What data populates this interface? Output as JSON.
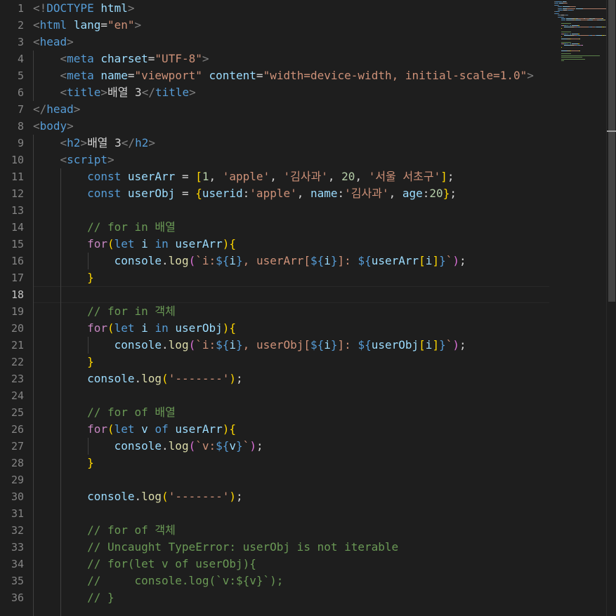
{
  "editor": {
    "active_line": "18",
    "line_numbers": [
      "1",
      "2",
      "3",
      "4",
      "5",
      "6",
      "7",
      "8",
      "9",
      "10",
      "11",
      "12",
      "13",
      "14",
      "15",
      "16",
      "17",
      "18",
      "19",
      "20",
      "21",
      "22",
      "23",
      "24",
      "25",
      "26",
      "27",
      "28",
      "29",
      "30",
      "31",
      "32",
      "33",
      "34",
      "35",
      "36"
    ],
    "lines": [
      [
        [
          "t-br",
          "<!"
        ],
        [
          "t-tag",
          "DOCTYPE"
        ],
        [
          "t-txt",
          " "
        ],
        [
          "t-attr",
          "html"
        ],
        [
          "t-br",
          ">"
        ]
      ],
      [
        [
          "t-br",
          "<"
        ],
        [
          "t-tag",
          "html"
        ],
        [
          "t-txt",
          " "
        ],
        [
          "t-attr",
          "lang"
        ],
        [
          "t-txt",
          "="
        ],
        [
          "t-str",
          "\"en\""
        ],
        [
          "t-br",
          ">"
        ]
      ],
      [
        [
          "t-br",
          "<"
        ],
        [
          "t-tag",
          "head"
        ],
        [
          "t-br",
          ">"
        ]
      ],
      [
        [
          "t-txt",
          "    "
        ],
        [
          "t-br",
          "<"
        ],
        [
          "t-tag",
          "meta"
        ],
        [
          "t-txt",
          " "
        ],
        [
          "t-attr",
          "charset"
        ],
        [
          "t-txt",
          "="
        ],
        [
          "t-str",
          "\"UTF-8\""
        ],
        [
          "t-br",
          ">"
        ]
      ],
      [
        [
          "t-txt",
          "    "
        ],
        [
          "t-br",
          "<"
        ],
        [
          "t-tag",
          "meta"
        ],
        [
          "t-txt",
          " "
        ],
        [
          "t-attr",
          "name"
        ],
        [
          "t-txt",
          "="
        ],
        [
          "t-str",
          "\"viewport\""
        ],
        [
          "t-txt",
          " "
        ],
        [
          "t-attr",
          "content"
        ],
        [
          "t-txt",
          "="
        ],
        [
          "t-str",
          "\"width=device-width, initial-scale=1.0\""
        ],
        [
          "t-br",
          ">"
        ]
      ],
      [
        [
          "t-txt",
          "    "
        ],
        [
          "t-br",
          "<"
        ],
        [
          "t-tag",
          "title"
        ],
        [
          "t-br",
          ">"
        ],
        [
          "t-txt",
          "배열 3"
        ],
        [
          "t-br",
          "</"
        ],
        [
          "t-tag",
          "title"
        ],
        [
          "t-br",
          ">"
        ]
      ],
      [
        [
          "t-br",
          "</"
        ],
        [
          "t-tag",
          "head"
        ],
        [
          "t-br",
          ">"
        ]
      ],
      [
        [
          "t-br",
          "<"
        ],
        [
          "t-tag",
          "body"
        ],
        [
          "t-br",
          ">"
        ]
      ],
      [
        [
          "t-txt",
          "    "
        ],
        [
          "t-br",
          "<"
        ],
        [
          "t-tag",
          "h2"
        ],
        [
          "t-br",
          ">"
        ],
        [
          "t-txt",
          "배열 3"
        ],
        [
          "t-br",
          "</"
        ],
        [
          "t-tag",
          "h2"
        ],
        [
          "t-br",
          ">"
        ]
      ],
      [
        [
          "t-txt",
          "    "
        ],
        [
          "t-br",
          "<"
        ],
        [
          "t-tag",
          "script"
        ],
        [
          "t-br",
          ">"
        ]
      ],
      [
        [
          "t-txt",
          "        "
        ],
        [
          "t-kw",
          "const"
        ],
        [
          "t-txt",
          " "
        ],
        [
          "t-var",
          "userArr"
        ],
        [
          "t-txt",
          " = "
        ],
        [
          "t-p1",
          "["
        ],
        [
          "t-num",
          "1"
        ],
        [
          "t-txt",
          ", "
        ],
        [
          "t-str",
          "'apple'"
        ],
        [
          "t-txt",
          ", "
        ],
        [
          "t-str",
          "'김사과'"
        ],
        [
          "t-txt",
          ", "
        ],
        [
          "t-num",
          "20"
        ],
        [
          "t-txt",
          ", "
        ],
        [
          "t-str",
          "'서울 서초구'"
        ],
        [
          "t-p1",
          "]"
        ],
        [
          "t-txt",
          ";"
        ]
      ],
      [
        [
          "t-txt",
          "        "
        ],
        [
          "t-kw",
          "const"
        ],
        [
          "t-txt",
          " "
        ],
        [
          "t-var",
          "userObj"
        ],
        [
          "t-txt",
          " = "
        ],
        [
          "t-p1",
          "{"
        ],
        [
          "t-var",
          "userid"
        ],
        [
          "t-txt",
          ":"
        ],
        [
          "t-str",
          "'apple'"
        ],
        [
          "t-txt",
          ", "
        ],
        [
          "t-var",
          "name"
        ],
        [
          "t-txt",
          ":"
        ],
        [
          "t-str",
          "'김사과'"
        ],
        [
          "t-txt",
          ", "
        ],
        [
          "t-var",
          "age"
        ],
        [
          "t-txt",
          ":"
        ],
        [
          "t-num",
          "20"
        ],
        [
          "t-p1",
          "}"
        ],
        [
          "t-txt",
          ";"
        ]
      ],
      [],
      [
        [
          "t-txt",
          "        "
        ],
        [
          "t-com",
          "// for in 배열"
        ]
      ],
      [
        [
          "t-txt",
          "        "
        ],
        [
          "t-ctl",
          "for"
        ],
        [
          "t-p1",
          "("
        ],
        [
          "t-kw",
          "let"
        ],
        [
          "t-txt",
          " "
        ],
        [
          "t-var",
          "i"
        ],
        [
          "t-txt",
          " "
        ],
        [
          "t-kw",
          "in"
        ],
        [
          "t-txt",
          " "
        ],
        [
          "t-var",
          "userArr"
        ],
        [
          "t-p1",
          ")"
        ],
        [
          "t-p1",
          "{"
        ]
      ],
      [
        [
          "t-txt",
          "            "
        ],
        [
          "t-var",
          "console"
        ],
        [
          "t-txt",
          "."
        ],
        [
          "t-fn",
          "log"
        ],
        [
          "t-p2",
          "("
        ],
        [
          "t-str",
          "`i:"
        ],
        [
          "t-kw",
          "${"
        ],
        [
          "t-var",
          "i"
        ],
        [
          "t-kw",
          "}"
        ],
        [
          "t-str",
          ", userArr["
        ],
        [
          "t-kw",
          "${"
        ],
        [
          "t-var",
          "i"
        ],
        [
          "t-kw",
          "}"
        ],
        [
          "t-str",
          "]: "
        ],
        [
          "t-kw",
          "${"
        ],
        [
          "t-var",
          "userArr"
        ],
        [
          "t-p1",
          "["
        ],
        [
          "t-var",
          "i"
        ],
        [
          "t-p1",
          "]"
        ],
        [
          "t-kw",
          "}"
        ],
        [
          "t-str",
          "`"
        ],
        [
          "t-p2",
          ")"
        ],
        [
          "t-txt",
          ";"
        ]
      ],
      [
        [
          "t-txt",
          "        "
        ],
        [
          "t-p1",
          "}"
        ]
      ],
      [],
      [
        [
          "t-txt",
          "        "
        ],
        [
          "t-com",
          "// for in 객체"
        ]
      ],
      [
        [
          "t-txt",
          "        "
        ],
        [
          "t-ctl",
          "for"
        ],
        [
          "t-p1",
          "("
        ],
        [
          "t-kw",
          "let"
        ],
        [
          "t-txt",
          " "
        ],
        [
          "t-var",
          "i"
        ],
        [
          "t-txt",
          " "
        ],
        [
          "t-kw",
          "in"
        ],
        [
          "t-txt",
          " "
        ],
        [
          "t-var",
          "userObj"
        ],
        [
          "t-p1",
          ")"
        ],
        [
          "t-p1",
          "{"
        ]
      ],
      [
        [
          "t-txt",
          "            "
        ],
        [
          "t-var",
          "console"
        ],
        [
          "t-txt",
          "."
        ],
        [
          "t-fn",
          "log"
        ],
        [
          "t-p2",
          "("
        ],
        [
          "t-str",
          "`i:"
        ],
        [
          "t-kw",
          "${"
        ],
        [
          "t-var",
          "i"
        ],
        [
          "t-kw",
          "}"
        ],
        [
          "t-str",
          ", userObj["
        ],
        [
          "t-kw",
          "${"
        ],
        [
          "t-var",
          "i"
        ],
        [
          "t-kw",
          "}"
        ],
        [
          "t-str",
          "]: "
        ],
        [
          "t-kw",
          "${"
        ],
        [
          "t-var",
          "userObj"
        ],
        [
          "t-p1",
          "["
        ],
        [
          "t-var",
          "i"
        ],
        [
          "t-p1",
          "]"
        ],
        [
          "t-kw",
          "}"
        ],
        [
          "t-str",
          "`"
        ],
        [
          "t-p2",
          ")"
        ],
        [
          "t-txt",
          ";"
        ]
      ],
      [
        [
          "t-txt",
          "        "
        ],
        [
          "t-p1",
          "}"
        ]
      ],
      [
        [
          "t-txt",
          "        "
        ],
        [
          "t-var",
          "console"
        ],
        [
          "t-txt",
          "."
        ],
        [
          "t-fn",
          "log"
        ],
        [
          "t-p1",
          "("
        ],
        [
          "t-str",
          "'-------'"
        ],
        [
          "t-p1",
          ")"
        ],
        [
          "t-txt",
          ";"
        ]
      ],
      [],
      [
        [
          "t-txt",
          "        "
        ],
        [
          "t-com",
          "// for of 배열"
        ]
      ],
      [
        [
          "t-txt",
          "        "
        ],
        [
          "t-ctl",
          "for"
        ],
        [
          "t-p1",
          "("
        ],
        [
          "t-kw",
          "let"
        ],
        [
          "t-txt",
          " "
        ],
        [
          "t-var",
          "v"
        ],
        [
          "t-txt",
          " "
        ],
        [
          "t-kw",
          "of"
        ],
        [
          "t-txt",
          " "
        ],
        [
          "t-var",
          "userArr"
        ],
        [
          "t-p1",
          ")"
        ],
        [
          "t-p1",
          "{"
        ]
      ],
      [
        [
          "t-txt",
          "            "
        ],
        [
          "t-var",
          "console"
        ],
        [
          "t-txt",
          "."
        ],
        [
          "t-fn",
          "log"
        ],
        [
          "t-p2",
          "("
        ],
        [
          "t-str",
          "`v:"
        ],
        [
          "t-kw",
          "${"
        ],
        [
          "t-var",
          "v"
        ],
        [
          "t-kw",
          "}"
        ],
        [
          "t-str",
          "`"
        ],
        [
          "t-p2",
          ")"
        ],
        [
          "t-txt",
          ";"
        ]
      ],
      [
        [
          "t-txt",
          "        "
        ],
        [
          "t-p1",
          "}"
        ]
      ],
      [],
      [
        [
          "t-txt",
          "        "
        ],
        [
          "t-var",
          "console"
        ],
        [
          "t-txt",
          "."
        ],
        [
          "t-fn",
          "log"
        ],
        [
          "t-p1",
          "("
        ],
        [
          "t-str",
          "'-------'"
        ],
        [
          "t-p1",
          ")"
        ],
        [
          "t-txt",
          ";"
        ]
      ],
      [],
      [
        [
          "t-txt",
          "        "
        ],
        [
          "t-com",
          "// for of 객체"
        ]
      ],
      [
        [
          "t-txt",
          "        "
        ],
        [
          "t-com",
          "// Uncaught TypeError: userObj is not iterable"
        ]
      ],
      [
        [
          "t-txt",
          "        "
        ],
        [
          "t-com",
          "// for(let v of userObj){"
        ]
      ],
      [
        [
          "t-txt",
          "        "
        ],
        [
          "t-com",
          "//     console.log(`v:${v}`);"
        ]
      ],
      [
        [
          "t-txt",
          "        "
        ],
        [
          "t-com",
          "// }"
        ]
      ]
    ]
  },
  "colors": {
    "background": "#1e1e1e",
    "line_number": "#858585",
    "tag": "#569cd6",
    "string": "#ce9178",
    "attribute": "#9cdcfe",
    "comment": "#6a9955",
    "function": "#dcdcaa",
    "number": "#b5cea8",
    "control": "#c586c0",
    "bracket_gold": "#ffd700",
    "bracket_orchid": "#da70d6"
  }
}
